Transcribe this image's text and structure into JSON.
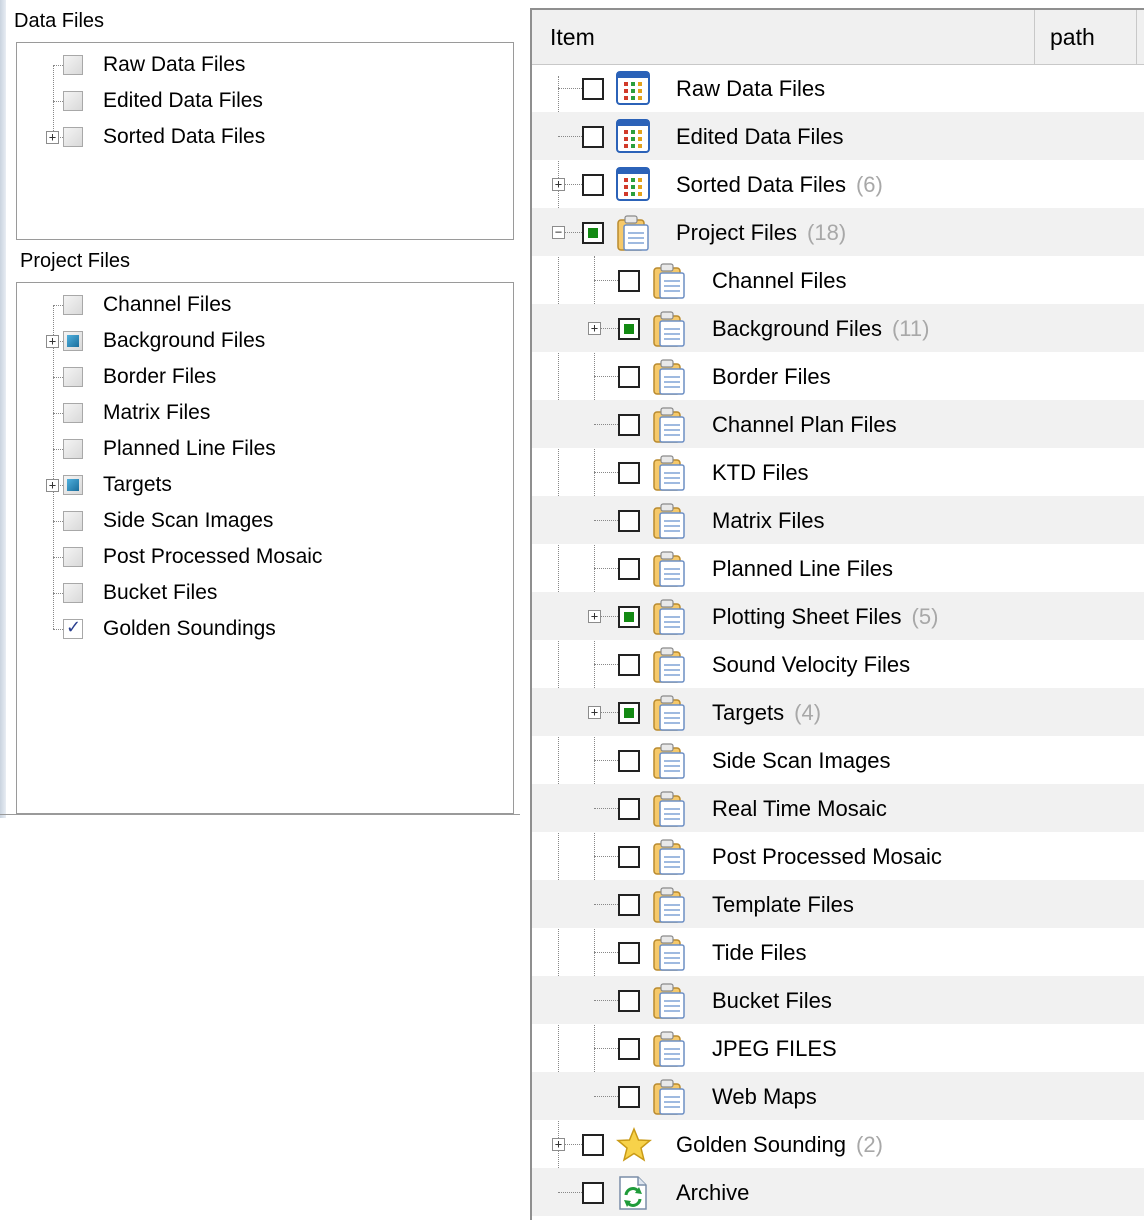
{
  "left": {
    "data_files": {
      "title": "Data Files",
      "items": [
        {
          "label": "Raw Data Files",
          "state": "unchecked",
          "expandable": false
        },
        {
          "label": "Edited Data Files",
          "state": "unchecked",
          "expandable": false
        },
        {
          "label": "Sorted Data Files",
          "state": "unchecked",
          "expandable": true
        }
      ]
    },
    "project_files": {
      "title": "Project Files",
      "items": [
        {
          "label": "Channel Files",
          "state": "unchecked",
          "expandable": false
        },
        {
          "label": "Background Files",
          "state": "partial",
          "expandable": true
        },
        {
          "label": "Border Files",
          "state": "unchecked",
          "expandable": false
        },
        {
          "label": "Matrix Files",
          "state": "unchecked",
          "expandable": false
        },
        {
          "label": "Planned Line Files",
          "state": "unchecked",
          "expandable": false
        },
        {
          "label": "Targets",
          "state": "partial",
          "expandable": true
        },
        {
          "label": "Side Scan Images",
          "state": "unchecked",
          "expandable": false
        },
        {
          "label": "Post Processed Mosaic",
          "state": "unchecked",
          "expandable": false
        },
        {
          "label": "Bucket Files",
          "state": "unchecked",
          "expandable": false
        },
        {
          "label": "Golden Soundings",
          "state": "checked",
          "expandable": false
        }
      ]
    }
  },
  "right": {
    "columns": {
      "item": "Item",
      "path": "path"
    },
    "rows": [
      {
        "label": "Raw Data Files",
        "count": "",
        "level": 0,
        "icon": "grid-icon",
        "state": "unchecked",
        "toggle": "none"
      },
      {
        "label": "Edited Data Files",
        "count": "",
        "level": 0,
        "icon": "grid-icon",
        "state": "unchecked",
        "toggle": "none"
      },
      {
        "label": "Sorted Data Files",
        "count": "(6)",
        "level": 0,
        "icon": "grid-icon",
        "state": "unchecked",
        "toggle": "plus"
      },
      {
        "label": "Project Files",
        "count": "(18)",
        "level": 0,
        "icon": "clipboard-icon",
        "state": "partial",
        "toggle": "minus"
      },
      {
        "label": "Channel Files",
        "count": "",
        "level": 1,
        "icon": "clipboard-icon",
        "state": "unchecked",
        "toggle": "none"
      },
      {
        "label": "Background Files",
        "count": "(11)",
        "level": 1,
        "icon": "clipboard-icon",
        "state": "partial",
        "toggle": "plus"
      },
      {
        "label": "Border Files",
        "count": "",
        "level": 1,
        "icon": "clipboard-icon",
        "state": "unchecked",
        "toggle": "none"
      },
      {
        "label": "Channel Plan Files",
        "count": "",
        "level": 1,
        "icon": "clipboard-icon",
        "state": "unchecked",
        "toggle": "none"
      },
      {
        "label": "KTD Files",
        "count": "",
        "level": 1,
        "icon": "clipboard-icon",
        "state": "unchecked",
        "toggle": "none"
      },
      {
        "label": "Matrix Files",
        "count": "",
        "level": 1,
        "icon": "clipboard-icon",
        "state": "unchecked",
        "toggle": "none"
      },
      {
        "label": "Planned Line Files",
        "count": "",
        "level": 1,
        "icon": "clipboard-icon",
        "state": "unchecked",
        "toggle": "none"
      },
      {
        "label": "Plotting Sheet Files",
        "count": "(5)",
        "level": 1,
        "icon": "clipboard-icon",
        "state": "partial",
        "toggle": "plus"
      },
      {
        "label": "Sound Velocity Files",
        "count": "",
        "level": 1,
        "icon": "clipboard-icon",
        "state": "unchecked",
        "toggle": "none"
      },
      {
        "label": "Targets",
        "count": "(4)",
        "level": 1,
        "icon": "clipboard-icon",
        "state": "partial",
        "toggle": "plus"
      },
      {
        "label": "Side Scan Images",
        "count": "",
        "level": 1,
        "icon": "clipboard-icon",
        "state": "unchecked",
        "toggle": "none"
      },
      {
        "label": "Real Time Mosaic",
        "count": "",
        "level": 1,
        "icon": "clipboard-icon",
        "state": "unchecked",
        "toggle": "none"
      },
      {
        "label": "Post Processed Mosaic",
        "count": "",
        "level": 1,
        "icon": "clipboard-icon",
        "state": "unchecked",
        "toggle": "none"
      },
      {
        "label": "Template Files",
        "count": "",
        "level": 1,
        "icon": "clipboard-icon",
        "state": "unchecked",
        "toggle": "none"
      },
      {
        "label": "Tide Files",
        "count": "",
        "level": 1,
        "icon": "clipboard-icon",
        "state": "unchecked",
        "toggle": "none"
      },
      {
        "label": "Bucket Files",
        "count": "",
        "level": 1,
        "icon": "clipboard-icon",
        "state": "unchecked",
        "toggle": "none"
      },
      {
        "label": "JPEG FILES",
        "count": "",
        "level": 1,
        "icon": "clipboard-icon",
        "state": "unchecked",
        "toggle": "none"
      },
      {
        "label": "Web Maps",
        "count": "",
        "level": 1,
        "icon": "clipboard-icon",
        "state": "unchecked",
        "toggle": "none"
      },
      {
        "label": "Golden Sounding",
        "count": "(2)",
        "level": 0,
        "icon": "star-icon",
        "state": "unchecked",
        "toggle": "plus"
      },
      {
        "label": "Archive",
        "count": "",
        "level": 0,
        "icon": "archive-refresh-icon",
        "state": "unchecked",
        "toggle": "none"
      }
    ]
  }
}
